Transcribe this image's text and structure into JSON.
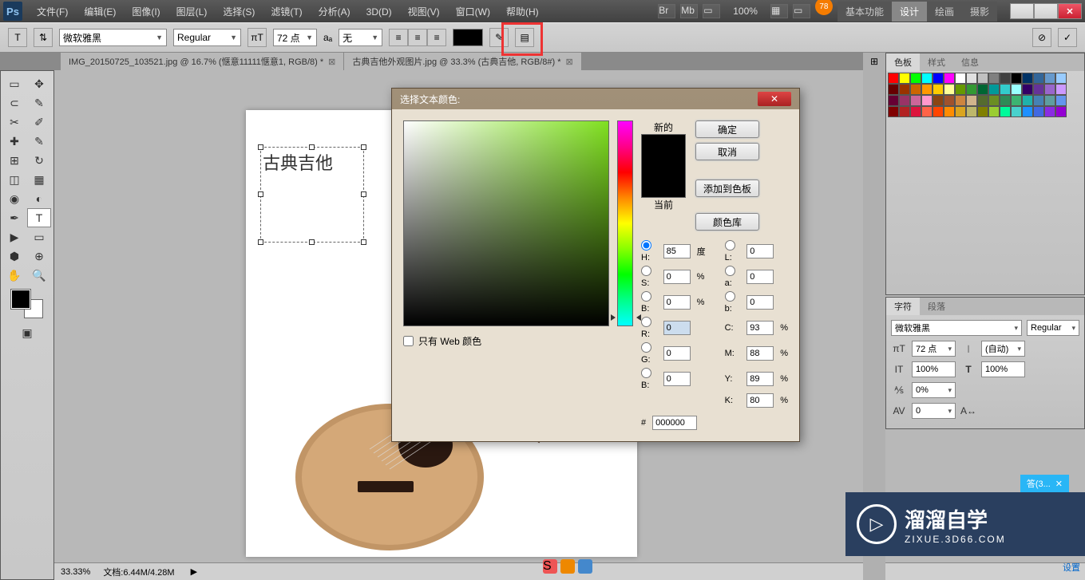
{
  "app": {
    "logo": "Ps"
  },
  "menu": [
    "文件(F)",
    "编辑(E)",
    "图像(I)",
    "图层(L)",
    "选择(S)",
    "滤镜(T)",
    "分析(A)",
    "3D(D)",
    "视图(V)",
    "窗口(W)",
    "帮助(H)"
  ],
  "top_right": {
    "badge": "78",
    "tabs": [
      "基本功能",
      "设计",
      "绘画",
      "摄影"
    ],
    "active_tab": 1,
    "zoom_label": "100%"
  },
  "options": {
    "font_family": "微软雅黑",
    "font_style": "Regular",
    "font_size": "72 点",
    "aa_label": "无",
    "color": "#000000"
  },
  "doc_tabs": [
    "IMG_20150725_103521.jpg @ 16.7% (惬意11111惬意1, RGB/8) *",
    "古典吉他外观图片.jpg @ 33.3% (古典吉他, RGB/8#) *"
  ],
  "canvas": {
    "text_sample": "古典吉他"
  },
  "status": {
    "zoom": "33.33%",
    "doc_info": "文档:6.44M/4.28M"
  },
  "picker": {
    "title": "选择文本颜色:",
    "new_label": "新的",
    "current_label": "当前",
    "ok": "确定",
    "cancel": "取消",
    "add_swatch": "添加到色板",
    "libraries": "颜色库",
    "web_only": "只有 Web 颜色",
    "H": "85",
    "S": "0",
    "B": "0",
    "L": "0",
    "a": "0",
    "b2": "0",
    "R": "0",
    "G": "0",
    "B2": "0",
    "C": "93",
    "M": "88",
    "Y": "89",
    "K": "80",
    "deg": "度",
    "pct": "%",
    "hex_label": "#",
    "hex": "000000"
  },
  "panels": {
    "p1": {
      "tabs": [
        "色板",
        "样式",
        "信息"
      ],
      "active": 0
    },
    "p2": {
      "tabs": [
        "字符",
        "段落"
      ],
      "active": 0
    },
    "char": {
      "font_family": "微软雅黑",
      "font_style": "Regular",
      "size": "72 点",
      "leading": "(自动)",
      "tracking_v": "100%",
      "tracking_h": "100%",
      "baseline": "0%",
      "kerning": "0"
    }
  },
  "swatch_colors": [
    "#ff0000",
    "#ffff00",
    "#00ff00",
    "#00ffff",
    "#0000ff",
    "#ff00ff",
    "#ffffff",
    "#e0e0e0",
    "#c0c0c0",
    "#808080",
    "#404040",
    "#000000",
    "#003366",
    "#336699",
    "#6699cc",
    "#99ccff",
    "#660000",
    "#993300",
    "#cc6600",
    "#ff9900",
    "#ffcc00",
    "#ffff99",
    "#669900",
    "#339933",
    "#006633",
    "#009999",
    "#33cccc",
    "#99ffff",
    "#330066",
    "#663399",
    "#9966cc",
    "#cc99ff",
    "#660033",
    "#993366",
    "#cc6699",
    "#ff99cc",
    "#8b4513",
    "#a0522d",
    "#cd853f",
    "#d2b48c",
    "#556b2f",
    "#6b8e23",
    "#2e8b57",
    "#3cb371",
    "#20b2aa",
    "#4682b4",
    "#5f9ea0",
    "#6495ed",
    "#800000",
    "#b22222",
    "#dc143c",
    "#ff6347",
    "#ff4500",
    "#ff8c00",
    "#daa520",
    "#bdb76b",
    "#808000",
    "#9acd32",
    "#00fa9a",
    "#48d1cc",
    "#1e90ff",
    "#4169e1",
    "#8a2be2",
    "#9400d3"
  ],
  "watermark": {
    "title": "溜溜自学",
    "sub": "ZIXUE.3D66.COM"
  },
  "answer_tab": "答(3...",
  "settings_label": "设置"
}
